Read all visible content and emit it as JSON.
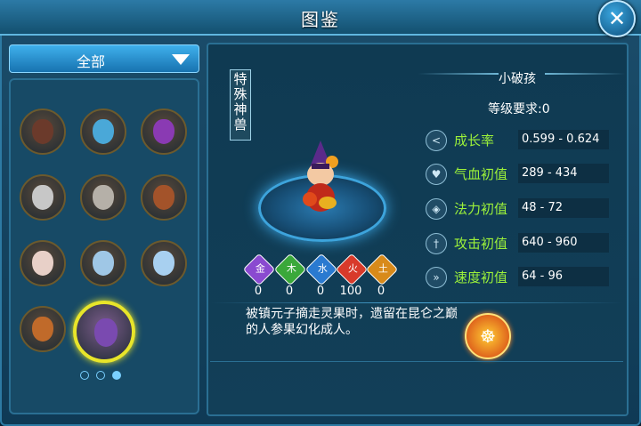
{
  "window": {
    "title": "图鉴",
    "close_label": "✕"
  },
  "filter": {
    "selected": "全部"
  },
  "pet_list": {
    "items": [
      {
        "name": "pet-1",
        "color": "#6b3a2b"
      },
      {
        "name": "pet-2",
        "color": "#4aa8d8"
      },
      {
        "name": "pet-3",
        "color": "#8a3ab3"
      },
      {
        "name": "pet-4",
        "color": "#c7c7c7"
      },
      {
        "name": "pet-5",
        "color": "#b5b0a8"
      },
      {
        "name": "pet-6",
        "color": "#a3532a"
      },
      {
        "name": "pet-7",
        "color": "#e8d0c8"
      },
      {
        "name": "pet-8",
        "color": "#9fc7e6"
      },
      {
        "name": "pet-9",
        "color": "#a8d0f0"
      },
      {
        "name": "pet-10",
        "color": "#c06a2a"
      },
      {
        "name": "pet-11-selected",
        "color": "#7a4ab0"
      }
    ],
    "page_count": 3,
    "current_page": 3
  },
  "detail": {
    "category_tag": "特殊神兽",
    "pet_name": "小破孩",
    "level_requirement": "等级要求:0",
    "stats": [
      {
        "icon": "share-icon",
        "label": "成长率",
        "value": "0.599 - 0.624"
      },
      {
        "icon": "heart-icon",
        "label": "气血初值",
        "value": "289 - 434"
      },
      {
        "icon": "shield-icon",
        "label": "法力初值",
        "value": "48 - 72"
      },
      {
        "icon": "sword-icon",
        "label": "攻击初值",
        "value": "640 - 960"
      },
      {
        "icon": "boot-icon",
        "label": "速度初值",
        "value": "64 - 96"
      }
    ],
    "elements": [
      {
        "label": "金",
        "value": "0",
        "color": "#8a4ad0"
      },
      {
        "label": "木",
        "value": "0",
        "color": "#3aa83a"
      },
      {
        "label": "水",
        "value": "0",
        "color": "#2a7ad0"
      },
      {
        "label": "火",
        "value": "100",
        "color": "#d83a2a"
      },
      {
        "label": "土",
        "value": "0",
        "color": "#d88a1a"
      }
    ],
    "description": "被镇元子摘走灵果时，遗留在昆仑之巅的人参果幻化成人。"
  }
}
